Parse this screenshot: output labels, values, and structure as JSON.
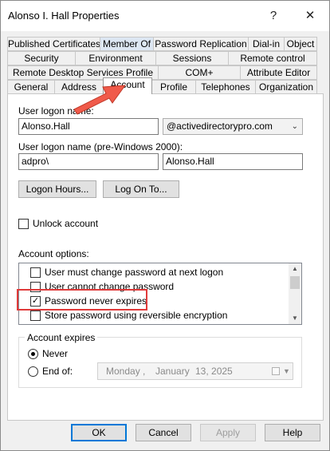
{
  "window": {
    "title": "Alonso I. Hall Properties",
    "help_glyph": "?",
    "close_glyph": "✕"
  },
  "tabs": {
    "row1": [
      "Published Certificates",
      "Member Of",
      "Password Replication",
      "Dial-in",
      "Object"
    ],
    "row2": [
      "Security",
      "Environment",
      "Sessions",
      "Remote control"
    ],
    "row3": [
      "Remote Desktop Services Profile",
      "COM+",
      "Attribute Editor"
    ],
    "row4": [
      "General",
      "Address",
      "Account",
      "Profile",
      "Telephones",
      "Organization"
    ],
    "selected": "Account"
  },
  "account": {
    "logon_name_label": "User logon name:",
    "logon_name_value": "Alonso.Hall",
    "domain_value": "@activedirectorypro.com",
    "pre2000_label": "User logon name (pre-Windows 2000):",
    "pre2000_domain": "adpro\\",
    "pre2000_user": "Alonso.Hall",
    "logon_hours_button": "Logon Hours...",
    "log_on_to_button": "Log On To...",
    "unlock_label": "Unlock account",
    "options_label": "Account options:",
    "options": [
      {
        "label": "User must change password at next logon",
        "checked": false
      },
      {
        "label": "User cannot change password",
        "checked": false
      },
      {
        "label": "Password never expires",
        "checked": true
      },
      {
        "label": "Store password using reversible encryption",
        "checked": false
      }
    ],
    "expires_label": "Account expires",
    "never_label": "Never",
    "end_of_label": "End of:",
    "end_date": {
      "weekday": "Monday",
      "sep1": ",",
      "month": "January",
      "day": "13, 2025"
    }
  },
  "footer": {
    "ok": "OK",
    "cancel": "Cancel",
    "apply": "Apply",
    "help": "Help"
  },
  "colors": {
    "highlight": "#e03a3a",
    "arrow": "#f05a4a",
    "default_button_border": "#0078d7"
  }
}
